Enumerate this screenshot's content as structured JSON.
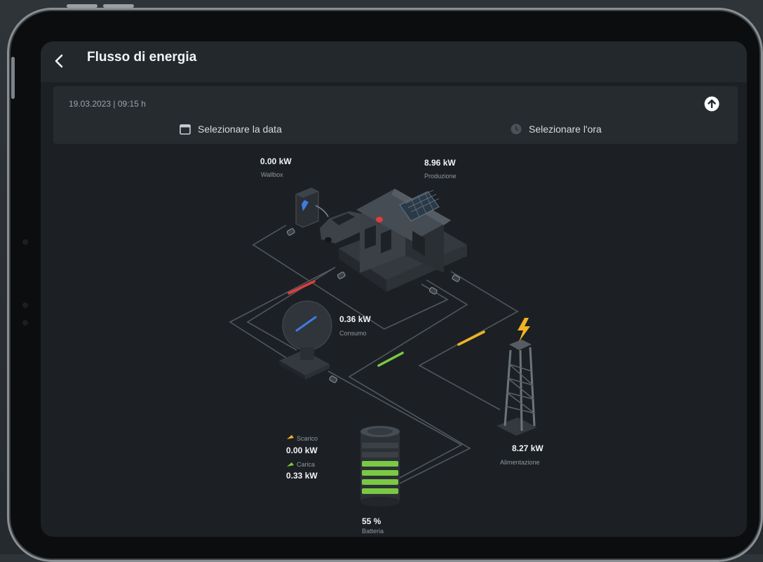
{
  "header": {
    "title": "Flusso di energia"
  },
  "panel": {
    "datetime": "19.03.2023 | 09:15 h",
    "date_button": "Selezionare la data",
    "time_button": "Selezionare l'ora"
  },
  "nodes": {
    "wallbox": {
      "value": "0.00 kW",
      "label": "Wallbox"
    },
    "production": {
      "value": "8.96 kW",
      "label": "Produzione"
    },
    "consumption": {
      "value": "0.36 kW",
      "label": "Consumo"
    },
    "grid": {
      "value": "8.27 kW",
      "label": "Alimentazione"
    },
    "battery": {
      "discharge_label": "Scarico",
      "discharge_value": "0.00 kW",
      "charge_label": "Carica",
      "charge_value": "0.33 kW",
      "level": "55 %",
      "label": "Batteria"
    }
  },
  "colors": {
    "accent_red": "#e23b3b",
    "accent_yellow": "#f0b323",
    "accent_green": "#7ac943",
    "accent_blue": "#3f7be0"
  }
}
